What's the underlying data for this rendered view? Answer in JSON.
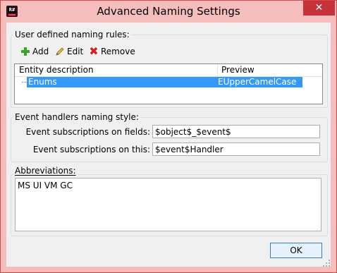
{
  "window": {
    "title": "Advanced Naming Settings",
    "close_glyph": "✕",
    "app_icon_text": "R#"
  },
  "rules_group": {
    "legend": "User defined naming rules:",
    "toolbar": {
      "add_label": "Add",
      "edit_label": "Edit",
      "remove_label": "Remove"
    },
    "list": {
      "columns": [
        "Entity description",
        "Preview"
      ],
      "rows": [
        {
          "entity": "Enums",
          "preview": "EUpperCamelCase",
          "selected": true
        }
      ]
    }
  },
  "event_group": {
    "legend": "Event handlers naming style:",
    "fields_label": "Event subscriptions on fields:",
    "fields_value": "$object$_$event$",
    "this_label": "Event subscriptions on this:",
    "this_value": "$event$Handler"
  },
  "abbrev_group": {
    "legend": "Abbreviations:",
    "value": "MS UI VM GC"
  },
  "ok_label": "OK",
  "colors": {
    "title_bar": "#f6bdbd",
    "close_button": "#c7323a",
    "selection": "#3399ff",
    "add_icon": "#3aa52a",
    "remove_icon": "#d21e1e"
  }
}
